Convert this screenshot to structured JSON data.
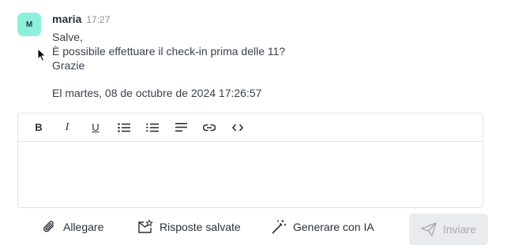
{
  "message": {
    "avatar_initial": "M",
    "author": "maria",
    "time": "17:27",
    "lines": [
      "Salve,",
      "È possibile effettuare il check-in prima delle 11?",
      "Grazie"
    ],
    "quoted_date": "El martes, 08 de octubre de 2024 17:26:57"
  },
  "toolbar": {
    "bold_label": "B",
    "italic_label": "I",
    "underline_label": "U",
    "buttons": [
      "bold",
      "italic",
      "underline",
      "bullet-list",
      "numbered-list",
      "align-left",
      "link",
      "code"
    ]
  },
  "editor": {
    "value": ""
  },
  "actions": {
    "attach_label": "Allegare",
    "saved_replies_label": "Risposte salvate",
    "generate_ai_label": "Generare con IA",
    "send_label": "Inviare"
  },
  "colors": {
    "avatar_bg": "#8ef0dc",
    "send_bg": "#e9ebee",
    "send_text": "#a6abb3",
    "border": "#e3e5e9"
  }
}
